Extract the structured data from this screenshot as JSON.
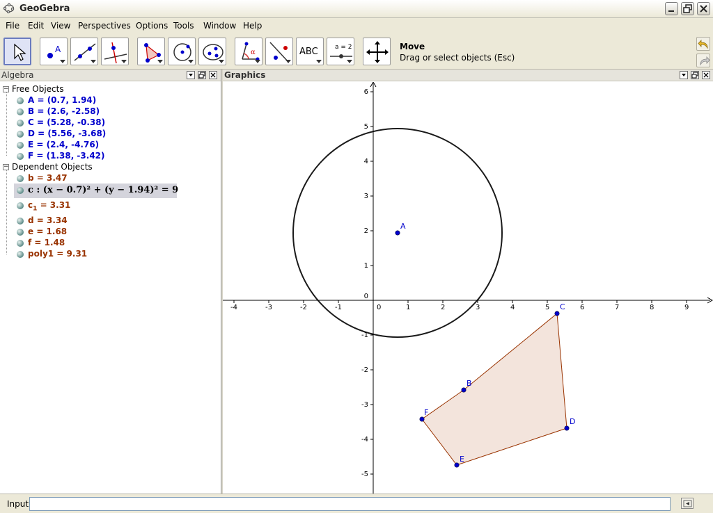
{
  "window": {
    "title": "GeoGebra"
  },
  "menu": [
    "File",
    "Edit",
    "View",
    "Perspectives",
    "Options",
    "Tools",
    "Window",
    "Help"
  ],
  "toolbar": {
    "tools": [
      "move-tool",
      "point-tool",
      "line-tool",
      "perpendicular-line-tool",
      "polygon-tool",
      "circle-center-point-tool",
      "conic-tool",
      "angle-tool",
      "reflect-tool",
      "text-tool",
      "slider-tool",
      "move-graphics-tool"
    ],
    "text_tool_label": "ABC",
    "slider_tool_label": "a = 2",
    "active_tool_name": "Move",
    "active_tool_help": "Drag or select objects (Esc)"
  },
  "algebra": {
    "title": "Algebra",
    "free_header": "Free Objects",
    "free_items": [
      "A = (0.7, 1.94)",
      "B = (2.6, -2.58)",
      "C = (5.28, -0.38)",
      "D = (5.56, -3.68)",
      "E = (2.4, -4.76)",
      "F = (1.38, -3.42)"
    ],
    "dependent_header": "Dependent Objects",
    "dependent": {
      "b": "b = 3.47",
      "c_prefix": "c : ",
      "c_eq": "(x − 0.7)² + (y − 1.94)² = 9",
      "c1_name": "c",
      "c1_sub": "1",
      "c1_value": " = 3.31",
      "d": "d = 3.34",
      "e": "e = 1.68",
      "f": "f = 1.48",
      "poly1": "poly1 = 9.31"
    }
  },
  "graphics": {
    "title": "Graphics",
    "x_ticks": [
      "-4",
      "-3",
      "-2",
      "-1",
      "0",
      "1",
      "2",
      "3",
      "4",
      "5",
      "6",
      "7",
      "8",
      "9"
    ],
    "y_ticks": [
      "6",
      "5",
      "4",
      "3",
      "2",
      "1",
      "0",
      "-1",
      "-2",
      "-3",
      "-4",
      "-5"
    ],
    "point_labels": {
      "A": "A",
      "B": "B",
      "C": "C",
      "D": "D",
      "E": "E",
      "F": "F"
    },
    "colors": {
      "point": "#0000cc",
      "polygon_fill": "#f3e4dc",
      "polygon_stroke": "#993300",
      "circle": "#1a1a1a"
    }
  },
  "input": {
    "label": "Input:"
  }
}
